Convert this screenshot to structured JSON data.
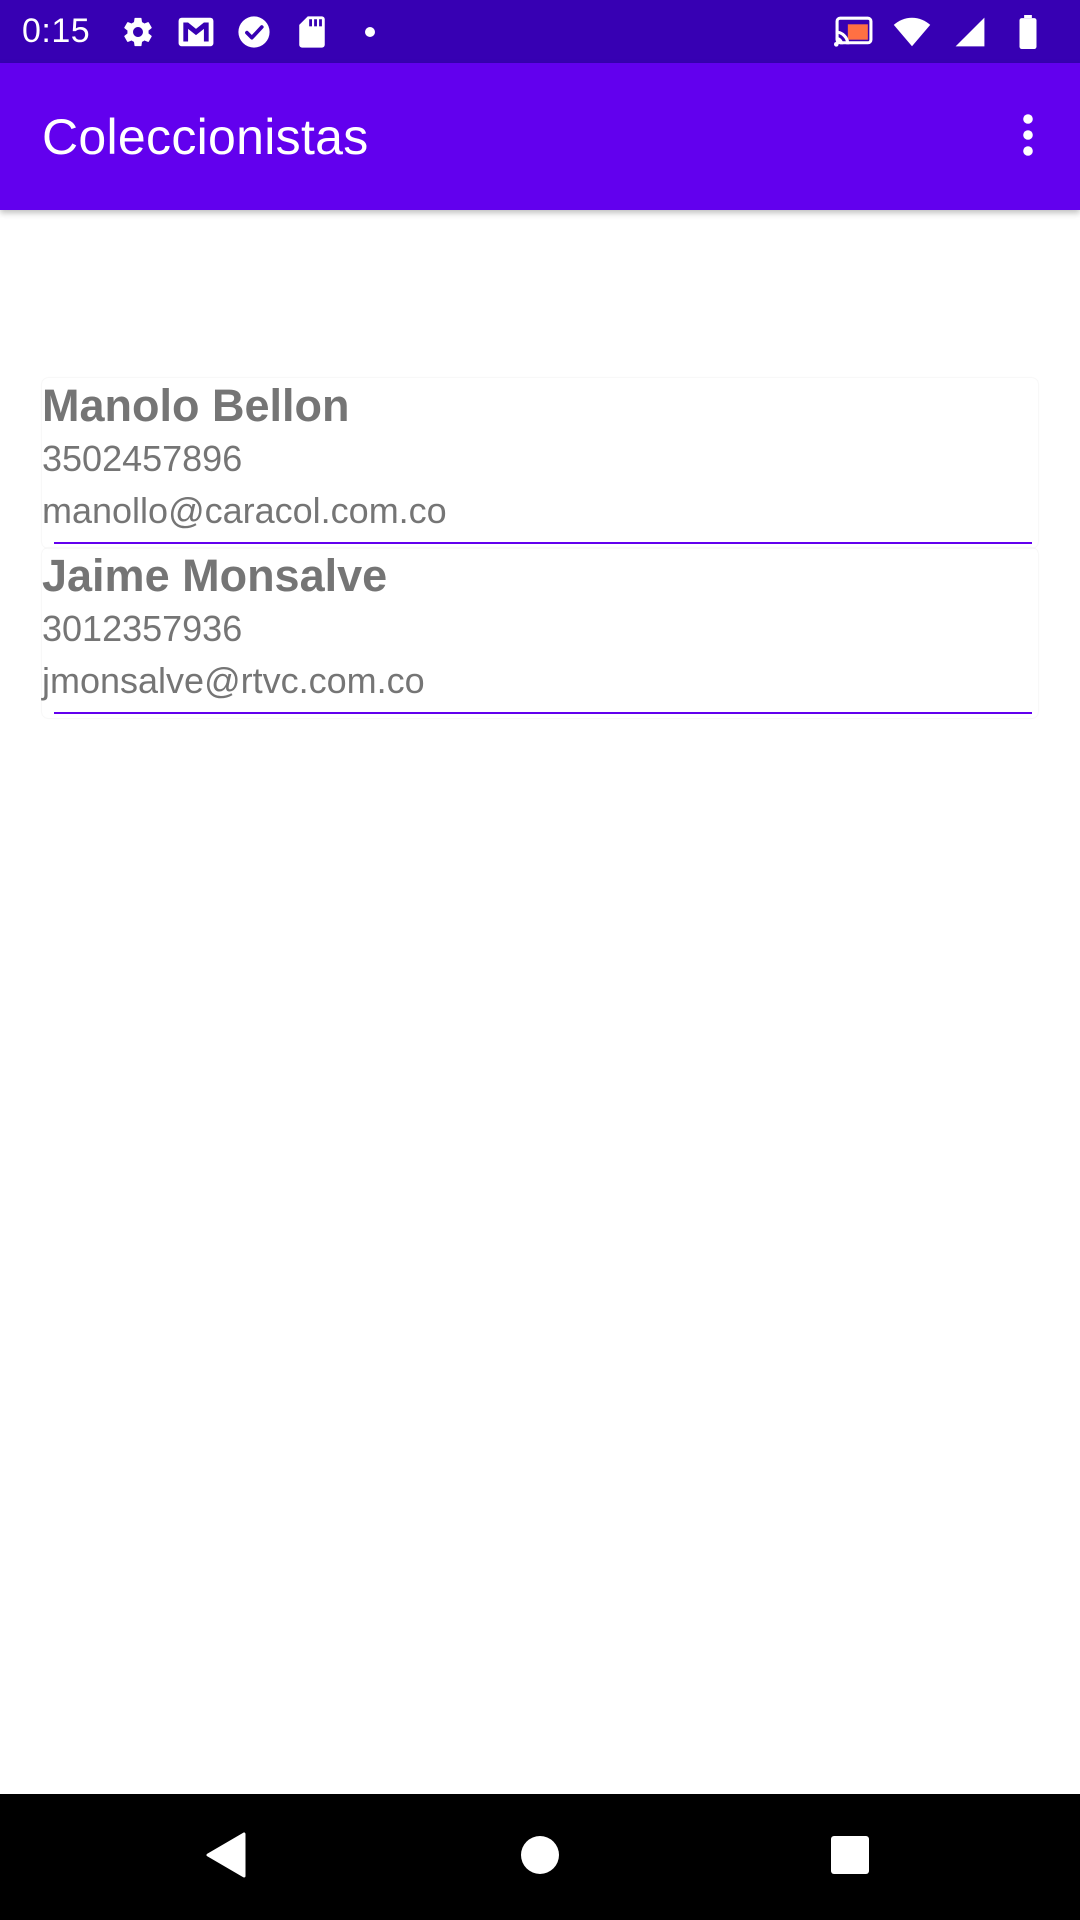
{
  "status_bar": {
    "time": "0:15",
    "icons_left": [
      "settings-icon",
      "gmail-icon",
      "check-circle-icon",
      "sd-card-icon",
      "dot-icon"
    ],
    "icons_right": [
      "cast-icon",
      "wifi-icon",
      "signal-icon",
      "battery-icon"
    ]
  },
  "app_bar": {
    "title": "Coleccionistas",
    "menu_icon": "more-vert-icon"
  },
  "collectors": [
    {
      "name": "Manolo Bellon",
      "phone": "3502457896",
      "email": "manollo@caracol.com.co"
    },
    {
      "name": "Jaime Monsalve",
      "phone": "3012357936",
      "email": "jmonsalve@rtvc.com.co"
    }
  ],
  "navigation": {
    "buttons": [
      "back-icon",
      "home-icon",
      "recents-icon"
    ]
  },
  "colors": {
    "status_bar": "#3700B3",
    "app_bar": "#6200EE",
    "text_secondary": "#757575",
    "divider": "#6200EE",
    "nav_bar": "#000000"
  }
}
